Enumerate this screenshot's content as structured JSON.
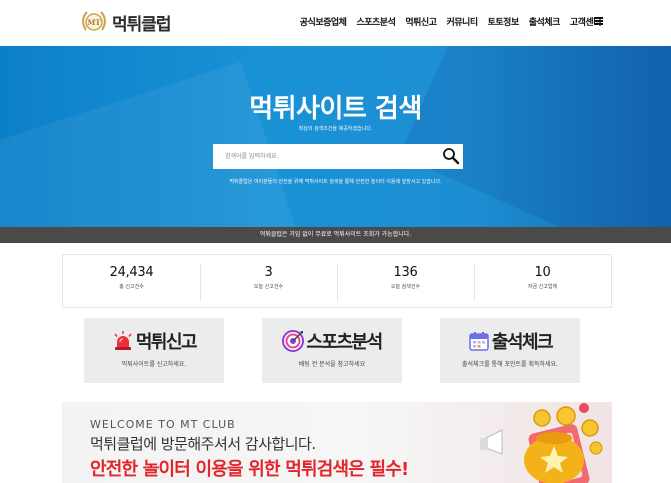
{
  "header": {
    "logo_badge": "MT",
    "logo_text": "먹튀클럽",
    "nav": [
      {
        "label": "공식보증업체"
      },
      {
        "label": "스포츠분석"
      },
      {
        "label": "먹튀신고"
      },
      {
        "label": "커뮤니티"
      },
      {
        "label": "토토정보"
      },
      {
        "label": "출석체크"
      },
      {
        "label": "고객센터"
      }
    ],
    "menu_icon": "hamburger-icon"
  },
  "hero": {
    "title": "먹튀사이트 검색",
    "subtitle": "최상의 검색조건을 제공하겠습니다.",
    "search": {
      "placeholder": "검색어를 입력하세요.",
      "value": "",
      "button_icon": "magnifier-icon"
    },
    "note": "먹튀클럽은 여러분들의 안전을 위해 먹튀사이트 검색을 통해 안전한 놀이터 이용에 앞장서고 있습니다."
  },
  "notice": "먹튀클럽은 가입 없이 무료로 먹튀사이트 조회가 가능합니다.",
  "stats": [
    {
      "value": "24,434",
      "label": "총 신고건수"
    },
    {
      "value": "3",
      "label": "오늘 신고건수"
    },
    {
      "value": "136",
      "label": "오늘 검색건수"
    },
    {
      "value": "10",
      "label": "자금 신고업체"
    }
  ],
  "cards": [
    {
      "title": "먹튀신고",
      "desc": "먹튀사이트를 신고하세요.",
      "icon": "siren-icon"
    },
    {
      "title": "스포츠분석",
      "desc": "배팅 전 분석을 참고하세요",
      "icon": "target-icon"
    },
    {
      "title": "출석체크",
      "desc": "출석체크를 통해 포인트를 획득하세요.",
      "icon": "calendar-icon"
    }
  ],
  "banner": {
    "welcome": "WELCOME TO MT CLUB",
    "line1": "먹튀클럽에 방문해주셔서 감사합니다.",
    "line2": "안전한 놀이터 이용을 위한 먹튀검색은 필수!"
  },
  "colors": {
    "hero_blue": "#1a92d6",
    "notice_bg": "#4a4a4a",
    "card_bg": "#ececec",
    "banner_red": "#e2262c",
    "logo_gold": "#c9a24a"
  }
}
